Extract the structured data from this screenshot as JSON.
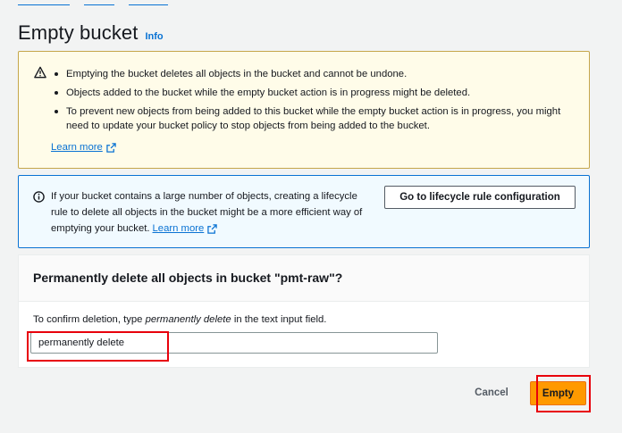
{
  "page": {
    "title": "Empty bucket",
    "info_link": "Info"
  },
  "warning": {
    "items": [
      "Emptying the bucket deletes all objects in the bucket and cannot be undone.",
      "Objects added to the bucket while the empty bucket action is in progress might be deleted.",
      "To prevent new objects from being added to this bucket while the empty bucket action is in progress, you might need to update your bucket policy to stop objects from being added to the bucket."
    ],
    "learn_more": "Learn more",
    "icon": "warning-icon",
    "border_color": "#c5a64b",
    "background": "#fffce9"
  },
  "info": {
    "text": "If your bucket contains a large number of objects, creating a lifecycle rule to delete all objects in the bucket might be a more efficient way of emptying your bucket.",
    "learn_more": "Learn more",
    "button_label": "Go to lifecycle rule configuration",
    "icon": "info-icon",
    "border_color": "#0972d3",
    "background": "#f1faff"
  },
  "confirm": {
    "heading": "Permanently delete all objects in bucket \"pmt-raw\"?",
    "instruction_prefix": "To confirm deletion, type ",
    "instruction_phrase": "permanently delete",
    "instruction_suffix": " in the text input field.",
    "input_value": "permanently delete"
  },
  "actions": {
    "cancel_label": "Cancel",
    "empty_label": "Empty",
    "primary_color": "#ff9900"
  },
  "annotations": {
    "highlight_color": "#e8000b"
  }
}
